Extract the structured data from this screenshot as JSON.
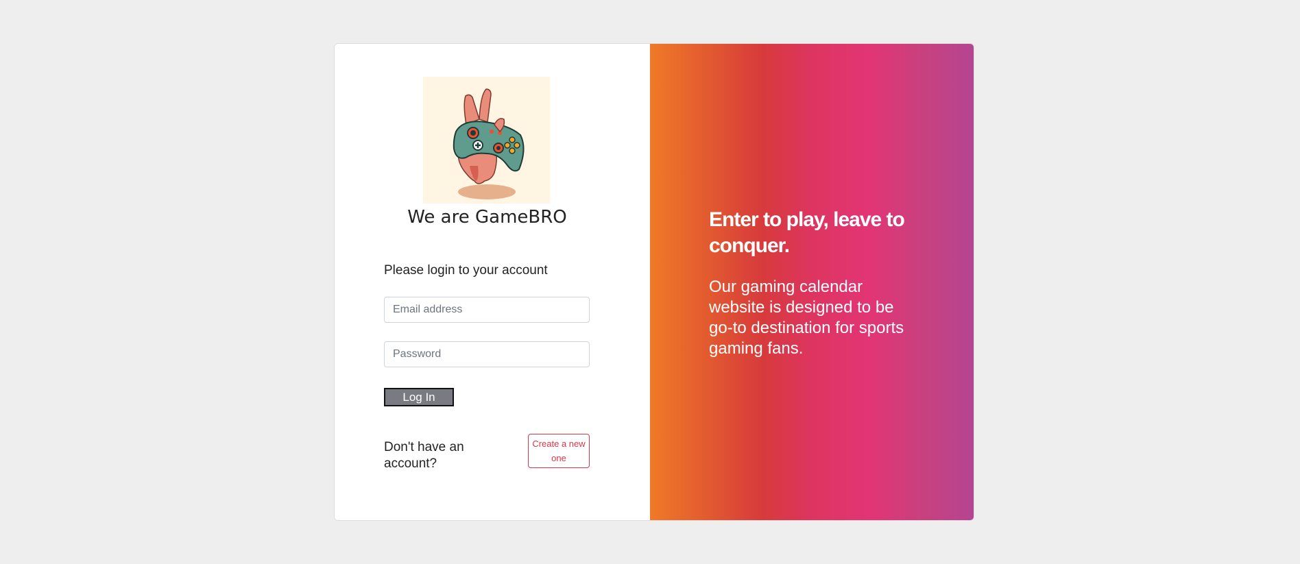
{
  "brand": {
    "logo_icon": "gamepad-peace-hand-icon",
    "name": "We are GameBRO"
  },
  "login": {
    "heading": "Please login to your account",
    "email_placeholder": "Email address",
    "password_placeholder": "Password",
    "submit_label": "Log In"
  },
  "signup": {
    "prompt": "Don't have an account?",
    "button_label": "Create a new one"
  },
  "promo": {
    "tagline": "Enter to play, leave to conquer.",
    "description": "Our gaming calendar website is designed to be go-to destination for sports gaming fans."
  },
  "colors": {
    "page_bg": "#eeeeee",
    "accent_red": "#dc3545",
    "gradient": [
      "#ef7a27",
      "#d73a3c",
      "#e23575",
      "#b44592"
    ]
  }
}
